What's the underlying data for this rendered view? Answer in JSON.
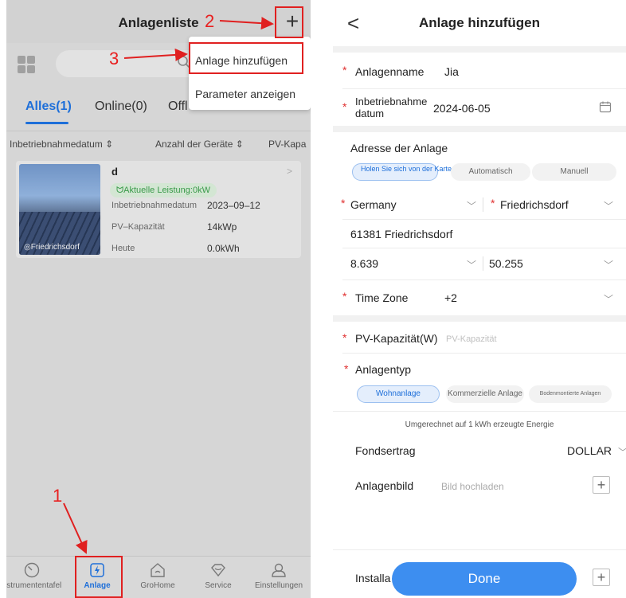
{
  "left": {
    "title": "Anlagenliste",
    "plus": "+",
    "annotations": {
      "one": "1",
      "two": "2",
      "three": "3"
    },
    "menu": {
      "add": "Anlage hinzufügen",
      "params": "Parameter anzeigen"
    },
    "tabs": {
      "all": "Alles(1)",
      "online": "Online(0)",
      "offline": "Offl",
      "rest": ""
    },
    "sort": {
      "commission": "Inbetriebnahmedatum ⇕",
      "devices": "Anzahl der Geräte ⇕",
      "capacity": "PV-Kapa"
    },
    "card": {
      "name": "d",
      "power": "ᗢAktuelle Leistung:0kW",
      "location": "◎Friedrichsdorf",
      "chevron": ">",
      "commission_label": "Inbetriebnahmedatum",
      "commission_value": "2023–09–12",
      "capacity_label": "PV–Kapazität",
      "capacity_value": "14kWp",
      "today_label": "Heute",
      "today_value": "0.0kWh"
    },
    "nav": [
      {
        "label": "nstrumententafel",
        "icon": "gauge-icon"
      },
      {
        "label": "Anlage",
        "icon": "plant-icon"
      },
      {
        "label": "GroHome",
        "icon": "home-icon"
      },
      {
        "label": "Service",
        "icon": "service-icon"
      },
      {
        "label": "Einstellungen",
        "icon": "user-icon"
      }
    ],
    "accent": "#1e6fd9",
    "annotation_color": "#e02020"
  },
  "right": {
    "title": "Anlage hinzufügen",
    "back": "<",
    "name_label": "Anlagenname",
    "name_value": "Jia",
    "date_label": "Inbetriebnahme\ndatum",
    "date_value": "2024-06-05",
    "address_label": "Adresse der Anlage",
    "address_modes": {
      "map": "Holen Sie sich von der Karte",
      "auto": "Automatisch",
      "manual": "Manuell"
    },
    "country": "Germany",
    "city": "Friedrichsdorf",
    "postal": "61381 Friedrichsdorf",
    "lon": "8.639",
    "lat": "50.255",
    "tz_label": "Time Zone",
    "tz_value": "+2",
    "pv_label": "PV-Kapazität(W)",
    "pv_placeholder": "PV-Kapazität",
    "type_label": "Anlagentyp",
    "types": {
      "residential": "Wohnanlage",
      "commercial": "Kommerzielle Anlage",
      "ground": "Bodenmontierte Anlagen"
    },
    "energy_note": "Umgerechnet auf 1 kWh erzeugte Energie",
    "fund_label": "Fondsertrag",
    "fund_value": "DOLLAR",
    "image_label": "Anlagenbild",
    "image_placeholder": "Bild hochladen",
    "install_label": "Installa",
    "done": "Done",
    "required_mark": "*",
    "accent": "#3d8ef0"
  }
}
